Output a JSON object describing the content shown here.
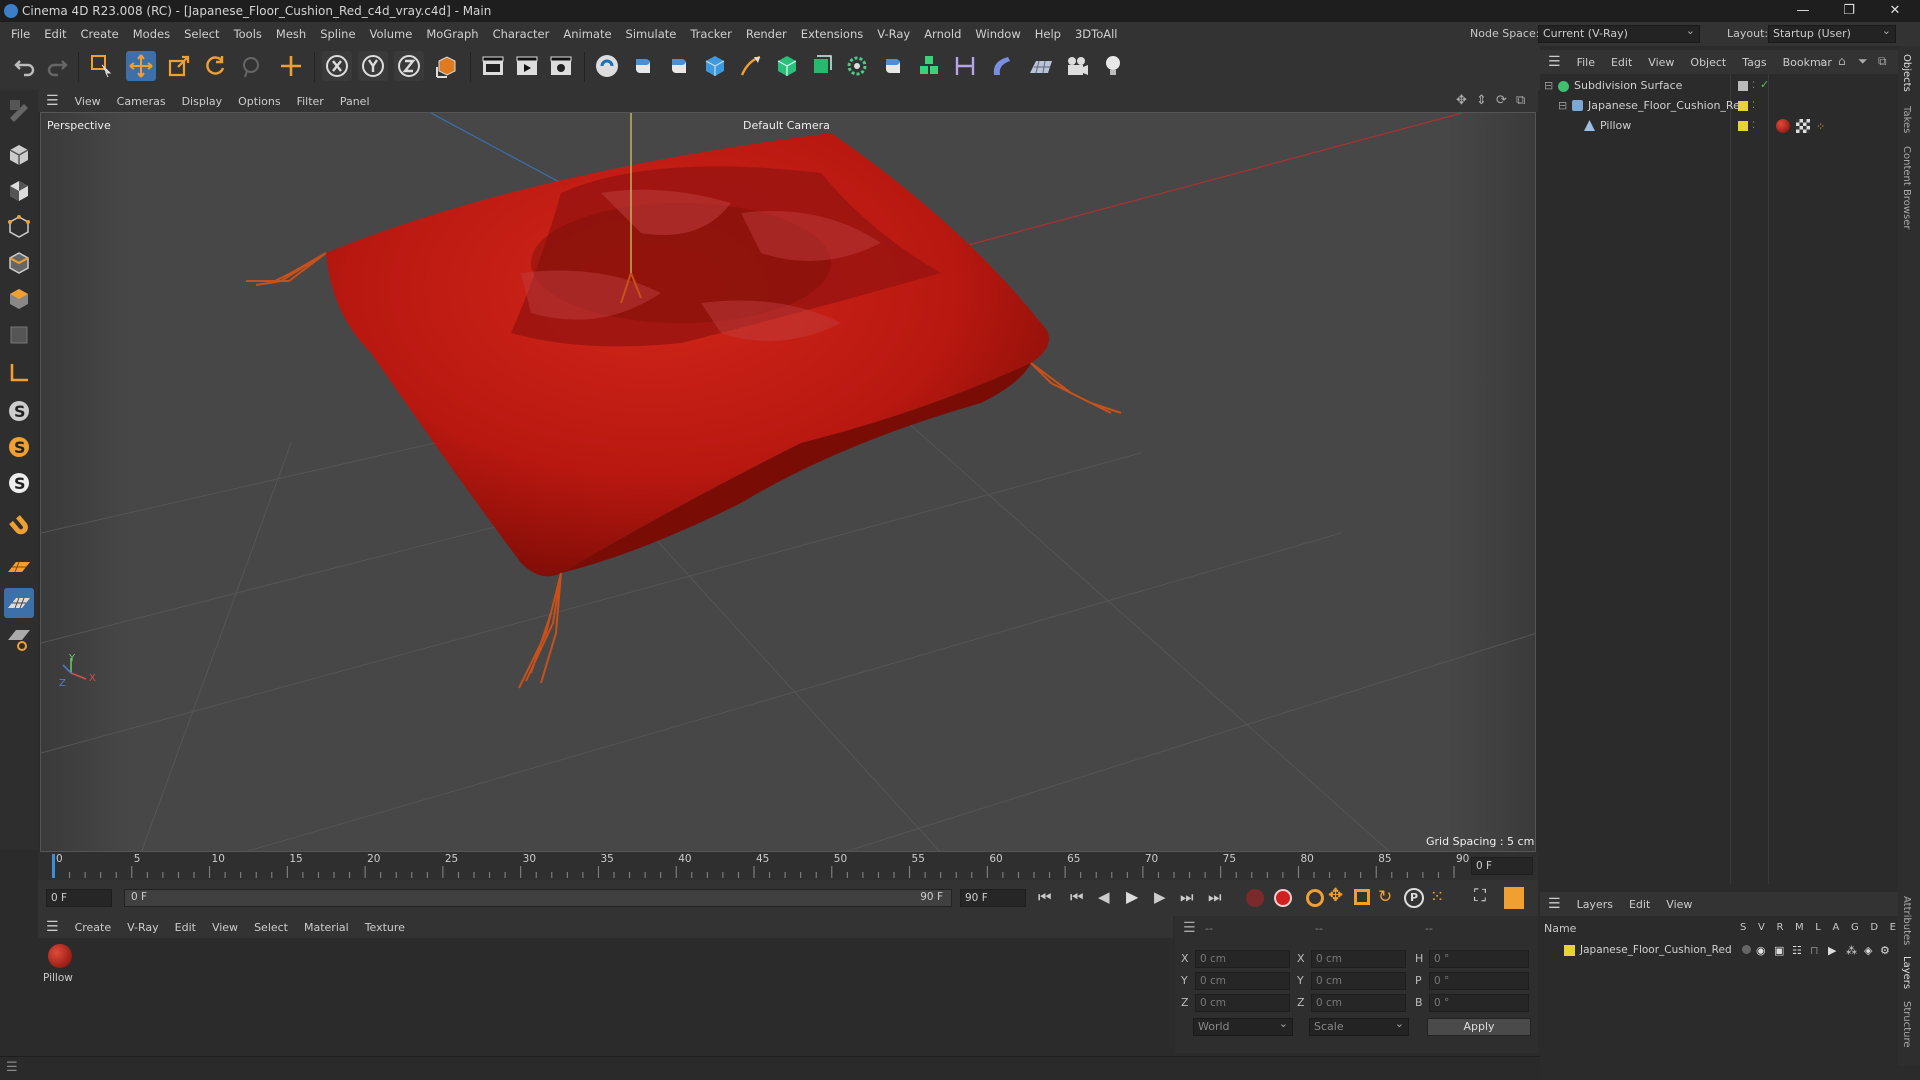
{
  "window": {
    "title": "Cinema 4D R23.008 (RC) - [Japanese_Floor_Cushion_Red_c4d_vray.c4d] - Main",
    "controls": [
      "—",
      "❐",
      "✕"
    ]
  },
  "menubar": {
    "items": [
      "File",
      "Edit",
      "Create",
      "Modes",
      "Select",
      "Tools",
      "Mesh",
      "Spline",
      "Volume",
      "MoGraph",
      "Character",
      "Animate",
      "Simulate",
      "Tracker",
      "Render",
      "Extensions",
      "V-Ray",
      "Arnold",
      "Window",
      "Help",
      "3DToAll"
    ],
    "node_space_label": "Node Space:",
    "node_space_value": "Current (V-Ray)",
    "layout_label": "Layout:",
    "layout_value": "Startup (User)"
  },
  "viewport": {
    "menu": [
      "View",
      "Cameras",
      "Display",
      "Options",
      "Filter",
      "Panel"
    ],
    "view_name": "Perspective",
    "camera_label": "Default Camera",
    "grid_spacing": "Grid Spacing : 5 cm",
    "axis_labels": {
      "x": "X",
      "y": "Y",
      "z": "Z"
    }
  },
  "timeline": {
    "ticks": [
      "0",
      "5",
      "10",
      "15",
      "20",
      "25",
      "30",
      "35",
      "40",
      "45",
      "50",
      "55",
      "60",
      "65",
      "70",
      "75",
      "80",
      "85",
      "90"
    ],
    "current_frame_field": "0 F"
  },
  "playback": {
    "start_field": "0 F",
    "range_start": "0 F",
    "range_end": "90 F",
    "end_field": "90 F"
  },
  "material_manager": {
    "menu": [
      "Create",
      "V-Ray",
      "Edit",
      "View",
      "Select",
      "Material",
      "Texture"
    ],
    "materials": [
      {
        "name": "Pillow"
      }
    ]
  },
  "coordinates": {
    "header_dashes": [
      "--",
      "--",
      "--"
    ],
    "rows": [
      {
        "pos_label": "X",
        "pos": "0 cm",
        "size_label": "X",
        "size": "0 cm",
        "rot_label": "H",
        "rot": "0 °"
      },
      {
        "pos_label": "Y",
        "pos": "0 cm",
        "size_label": "Y",
        "size": "0 cm",
        "rot_label": "P",
        "rot": "0 °"
      },
      {
        "pos_label": "Z",
        "pos": "0 cm",
        "size_label": "Z",
        "size": "0 cm",
        "rot_label": "B",
        "rot": "0 °"
      }
    ],
    "mode_dropdown": "World",
    "size_dropdown": "Scale",
    "apply_label": "Apply"
  },
  "object_manager": {
    "menu": [
      "File",
      "Edit",
      "View",
      "Object",
      "Tags",
      "Bookmar"
    ],
    "objects": [
      {
        "name": "Subdivision Surface",
        "depth": 0
      },
      {
        "name": "Japanese_Floor_Cushion_Red",
        "depth": 1
      },
      {
        "name": "Pillow",
        "depth": 2
      }
    ]
  },
  "layer_manager": {
    "menu": [
      "Layers",
      "Edit",
      "View"
    ],
    "name_header": "Name",
    "flag_headers": [
      "S",
      "V",
      "R",
      "M",
      "L",
      "A",
      "G",
      "D",
      "E"
    ],
    "layers": [
      {
        "name": "Japanese_Floor_Cushion_Red",
        "color": "#e8d23a"
      }
    ]
  },
  "side_tabs": [
    "Objects",
    "Takes",
    "Content Browser",
    "Attributes",
    "Layers",
    "Structure"
  ],
  "colors": {
    "accent_blue": "#3d8fd6",
    "cushion_red": "#c01a10",
    "layer_yellow": "#e8d23a",
    "check_green": "#4fc84f"
  }
}
